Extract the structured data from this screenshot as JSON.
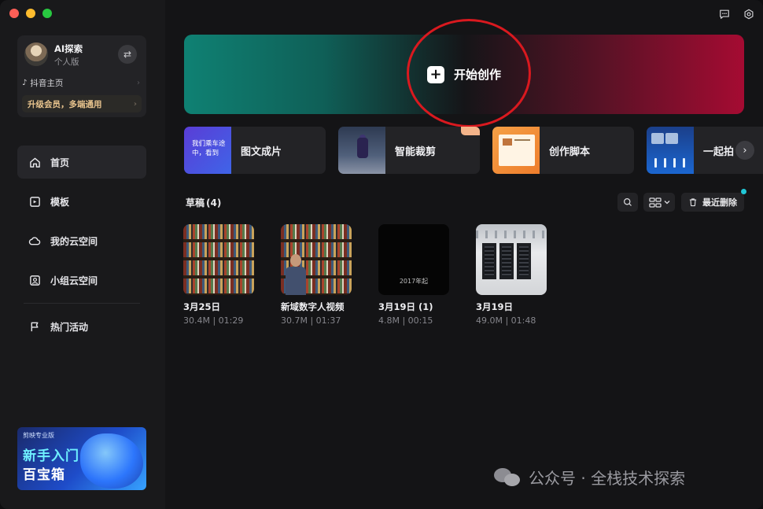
{
  "window": {
    "title": ""
  },
  "profile": {
    "name": "AI探索",
    "subtitle": "个人版",
    "douyin_label": "抖音主页",
    "upgrade_label": "升级会员，多端通用"
  },
  "nav": {
    "items": [
      {
        "label": "首页",
        "icon": "home-icon",
        "active": true
      },
      {
        "label": "模板",
        "icon": "template-icon",
        "active": false
      },
      {
        "label": "我的云空间",
        "icon": "cloud-icon",
        "active": false
      },
      {
        "label": "小组云空间",
        "icon": "team-cloud-icon",
        "active": false
      },
      {
        "label": "热门活动",
        "icon": "flag-icon",
        "active": false
      }
    ]
  },
  "promo": {
    "logo_text": "剪映专业版",
    "line1": "新手入门",
    "line2": "百宝箱"
  },
  "hero": {
    "label": "开始创作"
  },
  "features": [
    {
      "label": "图文成片",
      "thumb_text": "我们乘车途中，看到"
    },
    {
      "label": "智能裁剪",
      "badge": ""
    },
    {
      "label": "创作脚本"
    },
    {
      "label": "一起拍"
    }
  ],
  "drafts": {
    "title": "草稿",
    "count": "(4)",
    "recent_delete_label": "最近删除",
    "items": [
      {
        "name": "3月25日",
        "meta": "30.4M | 01:29",
        "thumb": "bookshelf"
      },
      {
        "name": "新域数字人视频",
        "meta": "30.7M | 01:37",
        "thumb": "bookshelf-person"
      },
      {
        "name": "3月19日 (1)",
        "meta": "4.8M | 00:15",
        "thumb": "black",
        "caption": "2017年起"
      },
      {
        "name": "3月19日",
        "meta": "49.0M | 01:48",
        "thumb": "server-room"
      }
    ]
  },
  "watermark": {
    "text": "公众号 · 全栈技术探索"
  },
  "colors": {
    "accent_hero_left": "#0f8173",
    "accent_hero_right": "#a50b32",
    "annotation_circle": "#d9191f",
    "upgrade_text": "#e9c48e",
    "badge_dot": "#21c7d6"
  }
}
